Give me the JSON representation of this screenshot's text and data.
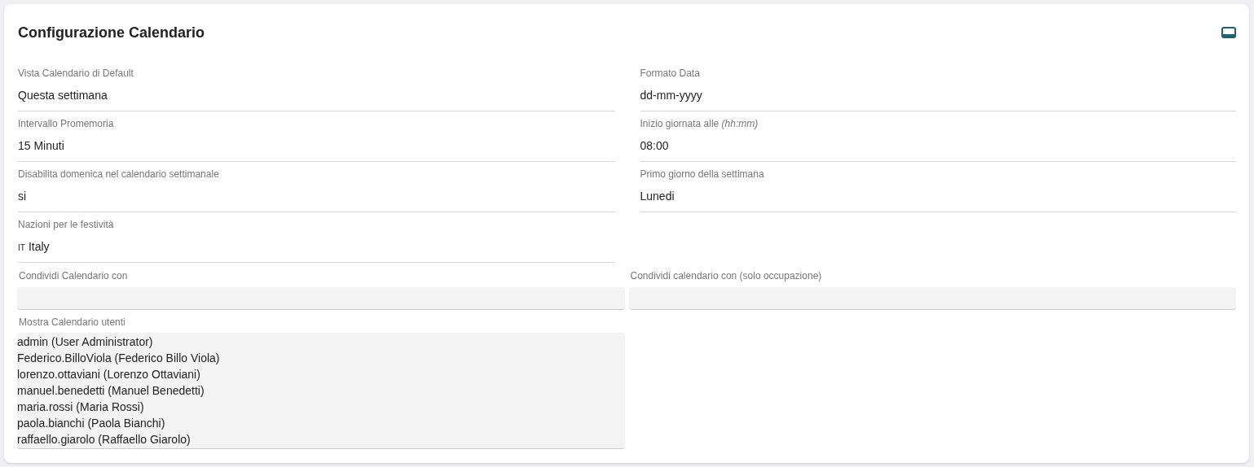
{
  "title": "Configurazione Calendario",
  "columns": [
    [
      {
        "label": "Vista Calendario di Default",
        "value": "Questa settimana"
      },
      {
        "label": "Intervallo Promemoria",
        "value": "15 Minuti"
      },
      {
        "label": "Disabilita domenica nel calendario settimanale",
        "value": "si"
      },
      {
        "label": "Nazioni per le festività",
        "flag": "IT",
        "value": "Italy"
      }
    ],
    [
      {
        "label": "Formato Data",
        "value": "dd-mm-yyyy"
      },
      {
        "label": "Inizio giornata alle *(hh:mm)*",
        "value": "08:00"
      },
      {
        "label": "Primo giorno della settimana",
        "value": "Lunedi"
      }
    ]
  ],
  "share_fields": [
    {
      "label": "Condividi Calendario con"
    },
    {
      "label": "Condividi calendario con (solo occupazione)"
    }
  ],
  "users_list": {
    "label": "Mostra Calendario utenti",
    "items": [
      "admin (User Administrator)",
      "Federico.BilloViola (Federico Billo Viola)",
      "lorenzo.ottaviani (Lorenzo Ottaviani)",
      "manuel.benedetti (Manuel Benedetti)",
      "maria.rossi (Maria Rossi)",
      "paola.bianchi (Paola Bianchi)",
      "raffaello.giarolo (Raffaello Giarolo)"
    ]
  }
}
